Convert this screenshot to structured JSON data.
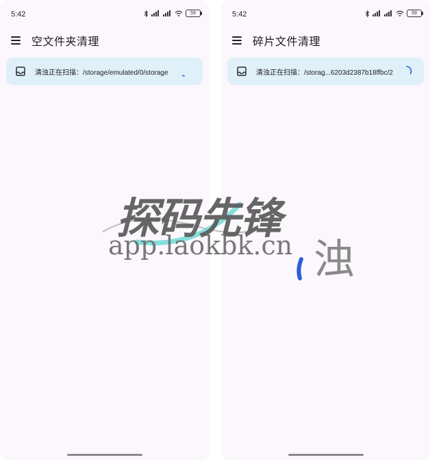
{
  "screens": [
    {
      "status": {
        "time": "5:42",
        "battery": "59"
      },
      "app_bar": {
        "title": "空文件夹清理"
      },
      "scan_card": {
        "text": "清浊正在扫描：/storage/emulated/0/storage"
      }
    },
    {
      "status": {
        "time": "5:42",
        "battery": "59"
      },
      "app_bar": {
        "title": "碎片文件清理"
      },
      "scan_card": {
        "text": "清浊正在扫描：/storag...6203d2387b18ffbc/2"
      }
    }
  ],
  "watermark": {
    "title": "探码先锋",
    "url": "app.laokbk.cn",
    "char": "浊"
  },
  "colors": {
    "screen_bg": "#fbf7fc",
    "card_bg": "#dff0f9",
    "spinner": "#3b6fd8"
  },
  "icons": [
    "bluetooth-icon",
    "signal-icon",
    "wifi-icon",
    "battery-icon",
    "menu-icon",
    "inbox-icon",
    "loading-spinner"
  ]
}
